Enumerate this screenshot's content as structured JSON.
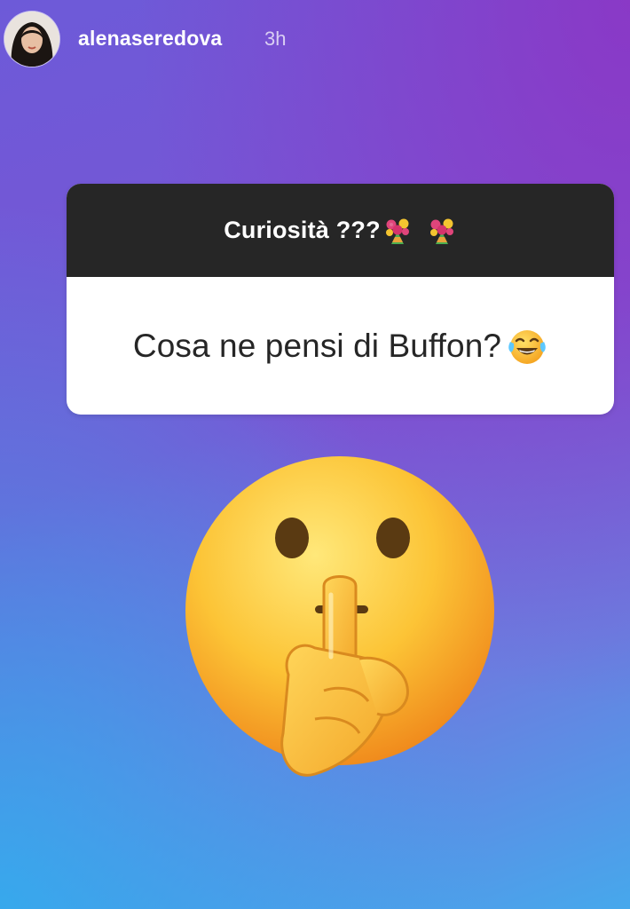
{
  "story": {
    "username": "alenaseredova",
    "time": "3h"
  },
  "question_sticker": {
    "title": "Curiosità ???",
    "title_emoji": [
      "bouquet-emoji",
      "bouquet-emoji"
    ],
    "question": "Cosa ne pensi di Buffon?",
    "question_emoji": "face-with-tears-of-joy-emoji"
  },
  "sticker": {
    "emoji": "shushing-face-emoji"
  },
  "colors": {
    "gradient_top_right": "#8a3fc6",
    "gradient_bottom_left": "#3fb1ee",
    "sticker_header": "#262626",
    "sticker_body": "#ffffff"
  }
}
